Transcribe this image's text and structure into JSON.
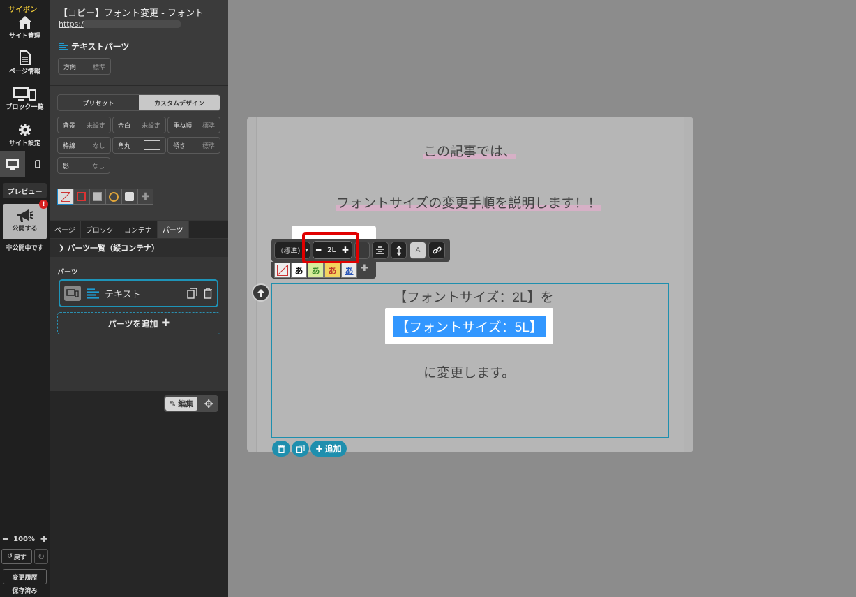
{
  "rail": {
    "brand": "サイボン",
    "site_manage": "サイト管理",
    "page_info": "ページ情報",
    "block_list": "ブロック一覧",
    "site_settings": "サイト設定",
    "preview": "プレビュー",
    "publish": "公開する",
    "badge": "!",
    "status": "非公開中です",
    "zoom_level": "100%",
    "undo": "戻す",
    "history": "変更履歴",
    "saved": "保存済み"
  },
  "panel": {
    "page_title": "【コピー】フォント変更 - フォント",
    "url_prefix": "https:/",
    "part_title": "テキストパーツ",
    "direction": {
      "label": "方向",
      "value": "標準"
    },
    "design_tabs": [
      "プリセット",
      "カスタムデザイン"
    ],
    "props": [
      {
        "label": "背景",
        "value": "未設定"
      },
      {
        "label": "余白",
        "value": "未設定"
      },
      {
        "label": "重ね順",
        "value": "標準"
      },
      {
        "label": "枠線",
        "value": "なし"
      },
      {
        "label": "角丸",
        "value": ""
      },
      {
        "label": "傾き",
        "value": "標準"
      },
      {
        "label": "影",
        "value": "なし"
      }
    ],
    "tabs": [
      "ページ",
      "ブロック",
      "コンテナ",
      "パーツ"
    ],
    "active_tab": "パーツ",
    "list_header": "パーツ一覧（縦コンテナ）",
    "parts_label": "パーツ",
    "part_item": "テキスト",
    "add_part": "パーツを追加",
    "edit": "編集"
  },
  "canvas": {
    "line1": "この記事では、",
    "line2": "フォントサイズの変更手順を説明します！！",
    "line3": "【フォントサイズ：2L】を",
    "selected_text": "【フォントサイズ：5L】",
    "line5": "に変更します。",
    "add_label": "追加"
  },
  "toolbar": {
    "style_select": "（標準）",
    "size_value": "2L",
    "color_letter": "A"
  },
  "colors": {
    "accent": "#1f8fae",
    "highlight": "#3297ff",
    "marker": "#d6b0c6",
    "callout": "#e00000"
  }
}
